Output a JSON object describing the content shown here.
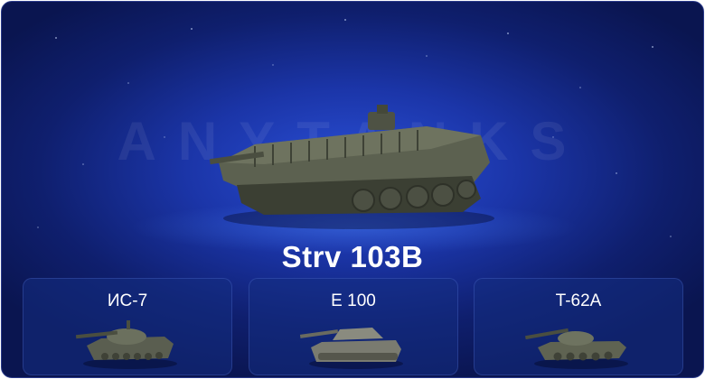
{
  "watermark": "ANYTANKS",
  "vehicle_title": "Strv 103B",
  "options": [
    {
      "label": "ИС-7",
      "icon": "heavy-tank-icon"
    },
    {
      "label": "E 100",
      "icon": "heavy-tank-icon"
    },
    {
      "label": "T-62A",
      "icon": "medium-tank-icon"
    }
  ],
  "colors": {
    "background": "#1b35a8",
    "card_border": "#2a3a8a",
    "text": "#ffffff"
  }
}
